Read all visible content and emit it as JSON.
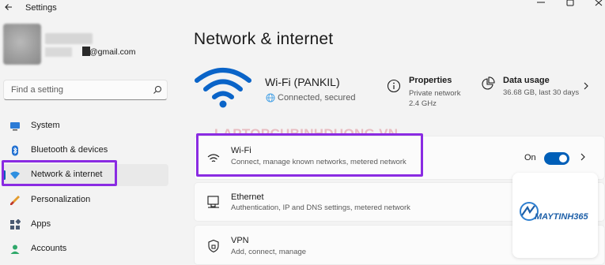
{
  "window": {
    "title": "Settings"
  },
  "user": {
    "email": "@gmail.com"
  },
  "search": {
    "placeholder": "Find a setting"
  },
  "sidebar": {
    "items": [
      {
        "label": "System",
        "icon": "monitor-icon"
      },
      {
        "label": "Bluetooth & devices",
        "icon": "bluetooth-icon"
      },
      {
        "label": "Network & internet",
        "icon": "network-icon",
        "active": true
      },
      {
        "label": "Personalization",
        "icon": "brush-icon"
      },
      {
        "label": "Apps",
        "icon": "apps-icon"
      },
      {
        "label": "Accounts",
        "icon": "person-icon"
      }
    ]
  },
  "main": {
    "page_title": "Network & internet",
    "network": {
      "name": "Wi-Fi (PANKIL)",
      "status": "Connected, secured"
    },
    "properties": {
      "title": "Properties",
      "line1": "Private network",
      "line2": "2.4 GHz"
    },
    "data_usage": {
      "title": "Data usage",
      "detail": "36.68 GB, last 30 days"
    },
    "watermark": "LAPTOPCUBINHDUONG.VN",
    "cards": [
      {
        "title": "Wi-Fi",
        "subtitle": "Connect, manage known networks, metered network",
        "toggle_label": "On",
        "toggle_on": true
      },
      {
        "title": "Ethernet",
        "subtitle": "Authentication, IP and DNS settings, metered network"
      },
      {
        "title": "VPN",
        "subtitle": "Add, connect, manage"
      }
    ]
  },
  "logo": {
    "name": "MAYTINH365"
  },
  "colors": {
    "accent": "#005fb8",
    "highlight": "#8a2be2",
    "background": "#f3f3f3"
  }
}
